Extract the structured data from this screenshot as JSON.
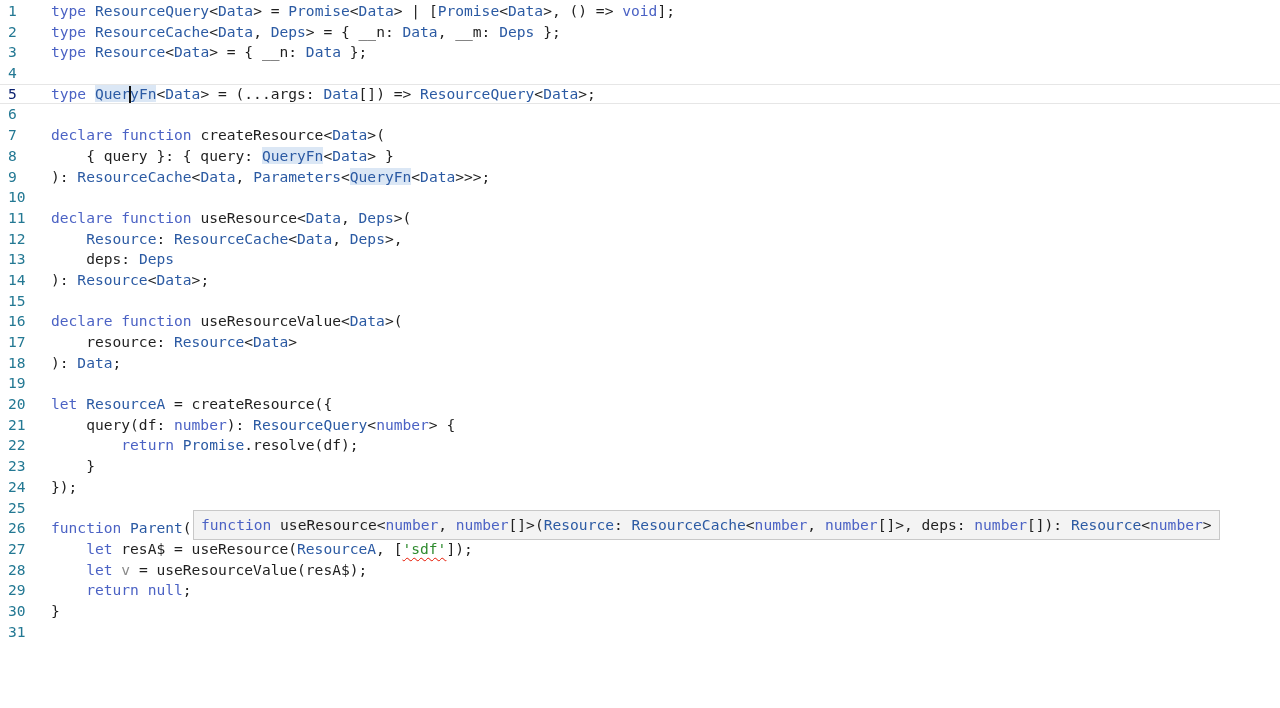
{
  "editor": {
    "lines": [
      {
        "number": "1",
        "current": false,
        "tokens": [
          {
            "text": "type ",
            "kind": "keyword"
          },
          {
            "text": "ResourceQuery",
            "kind": "type"
          },
          {
            "text": "<",
            "kind": "plain"
          },
          {
            "text": "Data",
            "kind": "type"
          },
          {
            "text": "> = ",
            "kind": "plain"
          },
          {
            "text": "Promise",
            "kind": "type"
          },
          {
            "text": "<",
            "kind": "plain"
          },
          {
            "text": "Data",
            "kind": "type"
          },
          {
            "text": "> | [",
            "kind": "plain"
          },
          {
            "text": "Promise",
            "kind": "type"
          },
          {
            "text": "<",
            "kind": "plain"
          },
          {
            "text": "Data",
            "kind": "type"
          },
          {
            "text": ">, () => ",
            "kind": "plain"
          },
          {
            "text": "void",
            "kind": "keyword"
          },
          {
            "text": "];",
            "kind": "plain"
          }
        ]
      },
      {
        "number": "2",
        "current": false,
        "tokens": [
          {
            "text": "type ",
            "kind": "keyword"
          },
          {
            "text": "ResourceCache",
            "kind": "type"
          },
          {
            "text": "<",
            "kind": "plain"
          },
          {
            "text": "Data",
            "kind": "type"
          },
          {
            "text": ", ",
            "kind": "plain"
          },
          {
            "text": "Deps",
            "kind": "type"
          },
          {
            "text": "> = { __n: ",
            "kind": "plain"
          },
          {
            "text": "Data",
            "kind": "type"
          },
          {
            "text": ", __m: ",
            "kind": "plain"
          },
          {
            "text": "Deps",
            "kind": "type"
          },
          {
            "text": " };",
            "kind": "plain"
          }
        ]
      },
      {
        "number": "3",
        "current": false,
        "tokens": [
          {
            "text": "type ",
            "kind": "keyword"
          },
          {
            "text": "Resource",
            "kind": "type"
          },
          {
            "text": "<",
            "kind": "plain"
          },
          {
            "text": "Data",
            "kind": "type"
          },
          {
            "text": "> = { __n: ",
            "kind": "plain"
          },
          {
            "text": "Data",
            "kind": "type"
          },
          {
            "text": " };",
            "kind": "plain"
          }
        ]
      },
      {
        "number": "4",
        "current": false
      },
      {
        "number": "5",
        "current": true,
        "tokens": [
          {
            "text": "type ",
            "kind": "keyword"
          },
          {
            "text": "Quer",
            "kind": "type",
            "highlight": true
          },
          {
            "text": "yFn",
            "kind": "type",
            "highlight": true,
            "caret": true
          },
          {
            "text": "<",
            "kind": "plain"
          },
          {
            "text": "Data",
            "kind": "type"
          },
          {
            "text": "> = (...args: ",
            "kind": "plain"
          },
          {
            "text": "Data",
            "kind": "type"
          },
          {
            "text": "[]) => ",
            "kind": "plain"
          },
          {
            "text": "ResourceQuery",
            "kind": "type"
          },
          {
            "text": "<",
            "kind": "plain"
          },
          {
            "text": "Data",
            "kind": "type"
          },
          {
            "text": ">;",
            "kind": "plain"
          }
        ]
      },
      {
        "number": "6",
        "current": false
      },
      {
        "number": "7",
        "current": false,
        "tokens": [
          {
            "text": "declare function",
            "kind": "keyword"
          },
          {
            "text": " createResource<",
            "kind": "plain"
          },
          {
            "text": "Data",
            "kind": "type"
          },
          {
            "text": ">(",
            "kind": "plain"
          }
        ]
      },
      {
        "number": "8",
        "current": false,
        "tokens": [
          {
            "text": "    { query }: { query: ",
            "kind": "plain"
          },
          {
            "text": "QueryFn",
            "kind": "type",
            "highlight": true
          },
          {
            "text": "<",
            "kind": "plain"
          },
          {
            "text": "Data",
            "kind": "type"
          },
          {
            "text": "> }",
            "kind": "plain"
          }
        ]
      },
      {
        "number": "9",
        "current": false,
        "tokens": [
          {
            "text": "): ",
            "kind": "plain"
          },
          {
            "text": "ResourceCache",
            "kind": "type"
          },
          {
            "text": "<",
            "kind": "plain"
          },
          {
            "text": "Data",
            "kind": "type"
          },
          {
            "text": ", ",
            "kind": "plain"
          },
          {
            "text": "Parameters",
            "kind": "type"
          },
          {
            "text": "<",
            "kind": "plain"
          },
          {
            "text": "QueryFn",
            "kind": "type",
            "highlight": true
          },
          {
            "text": "<",
            "kind": "plain"
          },
          {
            "text": "Data",
            "kind": "type"
          },
          {
            "text": ">>>;",
            "kind": "plain"
          }
        ]
      },
      {
        "number": "10",
        "current": false
      },
      {
        "number": "11",
        "current": false,
        "tokens": [
          {
            "text": "declare function",
            "kind": "keyword"
          },
          {
            "text": " useResource<",
            "kind": "plain"
          },
          {
            "text": "Data",
            "kind": "type"
          },
          {
            "text": ", ",
            "kind": "plain"
          },
          {
            "text": "Deps",
            "kind": "type"
          },
          {
            "text": ">(",
            "kind": "plain"
          }
        ]
      },
      {
        "number": "12",
        "current": false,
        "tokens": [
          {
            "text": "    Resource",
            "kind": "type"
          },
          {
            "text": ": ",
            "kind": "plain"
          },
          {
            "text": "ResourceCache",
            "kind": "type"
          },
          {
            "text": "<",
            "kind": "plain"
          },
          {
            "text": "Data",
            "kind": "type"
          },
          {
            "text": ", ",
            "kind": "plain"
          },
          {
            "text": "Deps",
            "kind": "type"
          },
          {
            "text": ">,",
            "kind": "plain"
          }
        ]
      },
      {
        "number": "13",
        "current": false,
        "tokens": [
          {
            "text": "    deps: ",
            "kind": "plain"
          },
          {
            "text": "Deps",
            "kind": "type"
          }
        ]
      },
      {
        "number": "14",
        "current": false,
        "tokens": [
          {
            "text": "): ",
            "kind": "plain"
          },
          {
            "text": "Resource",
            "kind": "type"
          },
          {
            "text": "<",
            "kind": "plain"
          },
          {
            "text": "Data",
            "kind": "type"
          },
          {
            "text": ">;",
            "kind": "plain"
          }
        ]
      },
      {
        "number": "15",
        "current": false
      },
      {
        "number": "16",
        "current": false,
        "tokens": [
          {
            "text": "declare function",
            "kind": "keyword"
          },
          {
            "text": " useResourceValue<",
            "kind": "plain"
          },
          {
            "text": "Data",
            "kind": "type"
          },
          {
            "text": ">(",
            "kind": "plain"
          }
        ]
      },
      {
        "number": "17",
        "current": false,
        "tokens": [
          {
            "text": "    resource: ",
            "kind": "plain"
          },
          {
            "text": "Resource",
            "kind": "type"
          },
          {
            "text": "<",
            "kind": "plain"
          },
          {
            "text": "Data",
            "kind": "type"
          },
          {
            "text": ">",
            "kind": "plain"
          }
        ]
      },
      {
        "number": "18",
        "current": false,
        "tokens": [
          {
            "text": "): ",
            "kind": "plain"
          },
          {
            "text": "Data",
            "kind": "type"
          },
          {
            "text": ";",
            "kind": "plain"
          }
        ]
      },
      {
        "number": "19",
        "current": false
      },
      {
        "number": "20",
        "current": false,
        "tokens": [
          {
            "text": "let ",
            "kind": "keyword"
          },
          {
            "text": "ResourceA",
            "kind": "type"
          },
          {
            "text": " = createResource({",
            "kind": "plain"
          }
        ]
      },
      {
        "number": "21",
        "current": false,
        "tokens": [
          {
            "text": "    query(df: ",
            "kind": "plain"
          },
          {
            "text": "number",
            "kind": "keyword"
          },
          {
            "text": "): ",
            "kind": "plain"
          },
          {
            "text": "ResourceQuery",
            "kind": "type"
          },
          {
            "text": "<",
            "kind": "plain"
          },
          {
            "text": "number",
            "kind": "keyword"
          },
          {
            "text": "> {",
            "kind": "plain"
          }
        ]
      },
      {
        "number": "22",
        "current": false,
        "tokens": [
          {
            "text": "        return ",
            "kind": "keyword"
          },
          {
            "text": "Promise",
            "kind": "type"
          },
          {
            "text": ".resolve(df);",
            "kind": "plain"
          }
        ]
      },
      {
        "number": "23",
        "current": false,
        "tokens": [
          {
            "text": "    }",
            "kind": "plain"
          }
        ]
      },
      {
        "number": "24",
        "current": false,
        "tokens": [
          {
            "text": "});",
            "kind": "plain"
          }
        ]
      },
      {
        "number": "25",
        "current": false
      },
      {
        "number": "26",
        "current": false,
        "tokens": [
          {
            "text": "function ",
            "kind": "keyword"
          },
          {
            "text": "Parent",
            "kind": "type"
          },
          {
            "text": "(",
            "kind": "plain"
          }
        ]
      },
      {
        "number": "27",
        "current": false,
        "tokens": [
          {
            "text": "    let",
            "kind": "keyword"
          },
          {
            "text": " resA$ = useResource(",
            "kind": "plain"
          },
          {
            "text": "ResourceA",
            "kind": "type"
          },
          {
            "text": ", [",
            "kind": "plain"
          },
          {
            "text": "'sdf'",
            "kind": "string",
            "error": true
          },
          {
            "text": "]);",
            "kind": "plain"
          }
        ]
      },
      {
        "number": "28",
        "current": false,
        "tokens": [
          {
            "text": "    let ",
            "kind": "keyword"
          },
          {
            "text": "v",
            "kind": "unused"
          },
          {
            "text": " = useResourceValue(resA$);",
            "kind": "plain"
          }
        ]
      },
      {
        "number": "29",
        "current": false,
        "tokens": [
          {
            "text": "    return null",
            "kind": "keyword"
          },
          {
            "text": ";",
            "kind": "plain"
          }
        ]
      },
      {
        "number": "30",
        "current": false,
        "tokens": [
          {
            "text": "}",
            "kind": "plain"
          }
        ]
      },
      {
        "number": "31",
        "current": false
      }
    ]
  },
  "hover_tooltip": {
    "tokens": [
      {
        "text": "function",
        "kind": "keyword"
      },
      {
        "text": " useResource<",
        "kind": "plain"
      },
      {
        "text": "number",
        "kind": "keyword"
      },
      {
        "text": ", ",
        "kind": "plain"
      },
      {
        "text": "number",
        "kind": "keyword"
      },
      {
        "text": "[]>(",
        "kind": "plain"
      },
      {
        "text": "Resource",
        "kind": "type"
      },
      {
        "text": ": ",
        "kind": "plain"
      },
      {
        "text": "ResourceCache",
        "kind": "type"
      },
      {
        "text": "<",
        "kind": "plain"
      },
      {
        "text": "number",
        "kind": "keyword"
      },
      {
        "text": ", ",
        "kind": "plain"
      },
      {
        "text": "number",
        "kind": "keyword"
      },
      {
        "text": "[]>, deps: ",
        "kind": "plain"
      },
      {
        "text": "number",
        "kind": "keyword"
      },
      {
        "text": "[]): ",
        "kind": "plain"
      },
      {
        "text": "Resource",
        "kind": "type"
      },
      {
        "text": "<",
        "kind": "plain"
      },
      {
        "text": "number",
        "kind": "keyword"
      },
      {
        "text": ">",
        "kind": "plain"
      }
    ]
  }
}
